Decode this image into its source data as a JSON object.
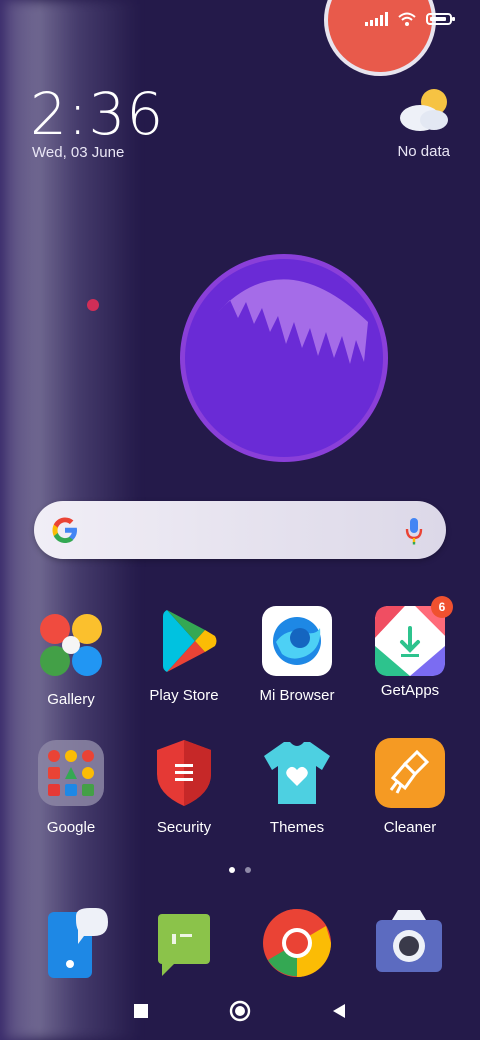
{
  "status_bar": {
    "icons": [
      "signal-icon",
      "wifi-icon",
      "battery-icon"
    ]
  },
  "clock": {
    "time": "2:36",
    "date": "Wed, 03 June"
  },
  "weather": {
    "icon": "partly-cloudy-icon",
    "label": "No data"
  },
  "search": {
    "placeholder": "",
    "icons": [
      "google-icon",
      "mic-icon"
    ]
  },
  "apps_row1": [
    {
      "label": "Gallery",
      "icon": "gallery-icon"
    },
    {
      "label": "Play Store",
      "icon": "play-store-icon"
    },
    {
      "label": "Mi Browser",
      "icon": "mi-browser-icon"
    },
    {
      "label": "GetApps",
      "icon": "getapps-icon",
      "badge": "6"
    }
  ],
  "apps_row2": [
    {
      "label": "Google",
      "icon": "google-folder-icon"
    },
    {
      "label": "Security",
      "icon": "security-icon"
    },
    {
      "label": "Themes",
      "icon": "themes-icon"
    },
    {
      "label": "Cleaner",
      "icon": "cleaner-icon"
    }
  ],
  "page_indicator": {
    "current": 1,
    "total": 2
  },
  "dock": [
    "phone-icon",
    "messages-icon",
    "chrome-icon",
    "camera-icon"
  ],
  "nav": [
    "recents-icon",
    "home-icon",
    "back-icon"
  ],
  "colors": {
    "background": "#241a4a",
    "orb": "#6a2bd6",
    "badge": "#f0512f"
  }
}
